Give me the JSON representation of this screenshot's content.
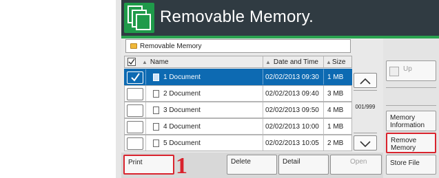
{
  "app": {
    "title": "Removable Memory."
  },
  "path": {
    "label": "Removable Memory"
  },
  "list": {
    "headers": {
      "name": "Name",
      "date": "Date and Time",
      "size": "Size"
    },
    "rows": [
      {
        "name": "1  Document",
        "date": "02/02/2013 09:30",
        "size": "1  MB",
        "selected": true
      },
      {
        "name": "2  Document",
        "date": "02/02/2013 09:40",
        "size": "3  MB",
        "selected": false
      },
      {
        "name": "3  Document",
        "date": "02/02/2013 09:50",
        "size": "4  MB",
        "selected": false
      },
      {
        "name": "4  Document",
        "date": "02/02/2013 10:00",
        "size": "1  MB",
        "selected": false
      },
      {
        "name": "5  Document",
        "date": "02/02/2013 10:05",
        "size": "2  MB",
        "selected": false
      }
    ]
  },
  "scroll": {
    "page_count": "001/999",
    "up_glyph": "︿",
    "down_glyph": "﹀"
  },
  "sidebar": {
    "up_label": "Up",
    "memory_info_label": "Memory Information",
    "remove_memory_label": "Remove Memory",
    "store_file_label": "Store File"
  },
  "bottom": {
    "print_label": "Print",
    "delete_label": "Delete",
    "detail_label": "Detail",
    "open_label": "Open"
  },
  "annotation": {
    "callout": "1"
  },
  "icons": {
    "title": "removable-memory-icon",
    "folder": "folder-icon",
    "document": "document-icon",
    "checkbox": "checkbox-icon",
    "up": "up-folder-icon"
  },
  "colors": {
    "titlebar": "#303b42",
    "accent_green": "#2aa24f",
    "selection_blue": "#0d6ab2",
    "highlight_red": "#d9232d"
  }
}
